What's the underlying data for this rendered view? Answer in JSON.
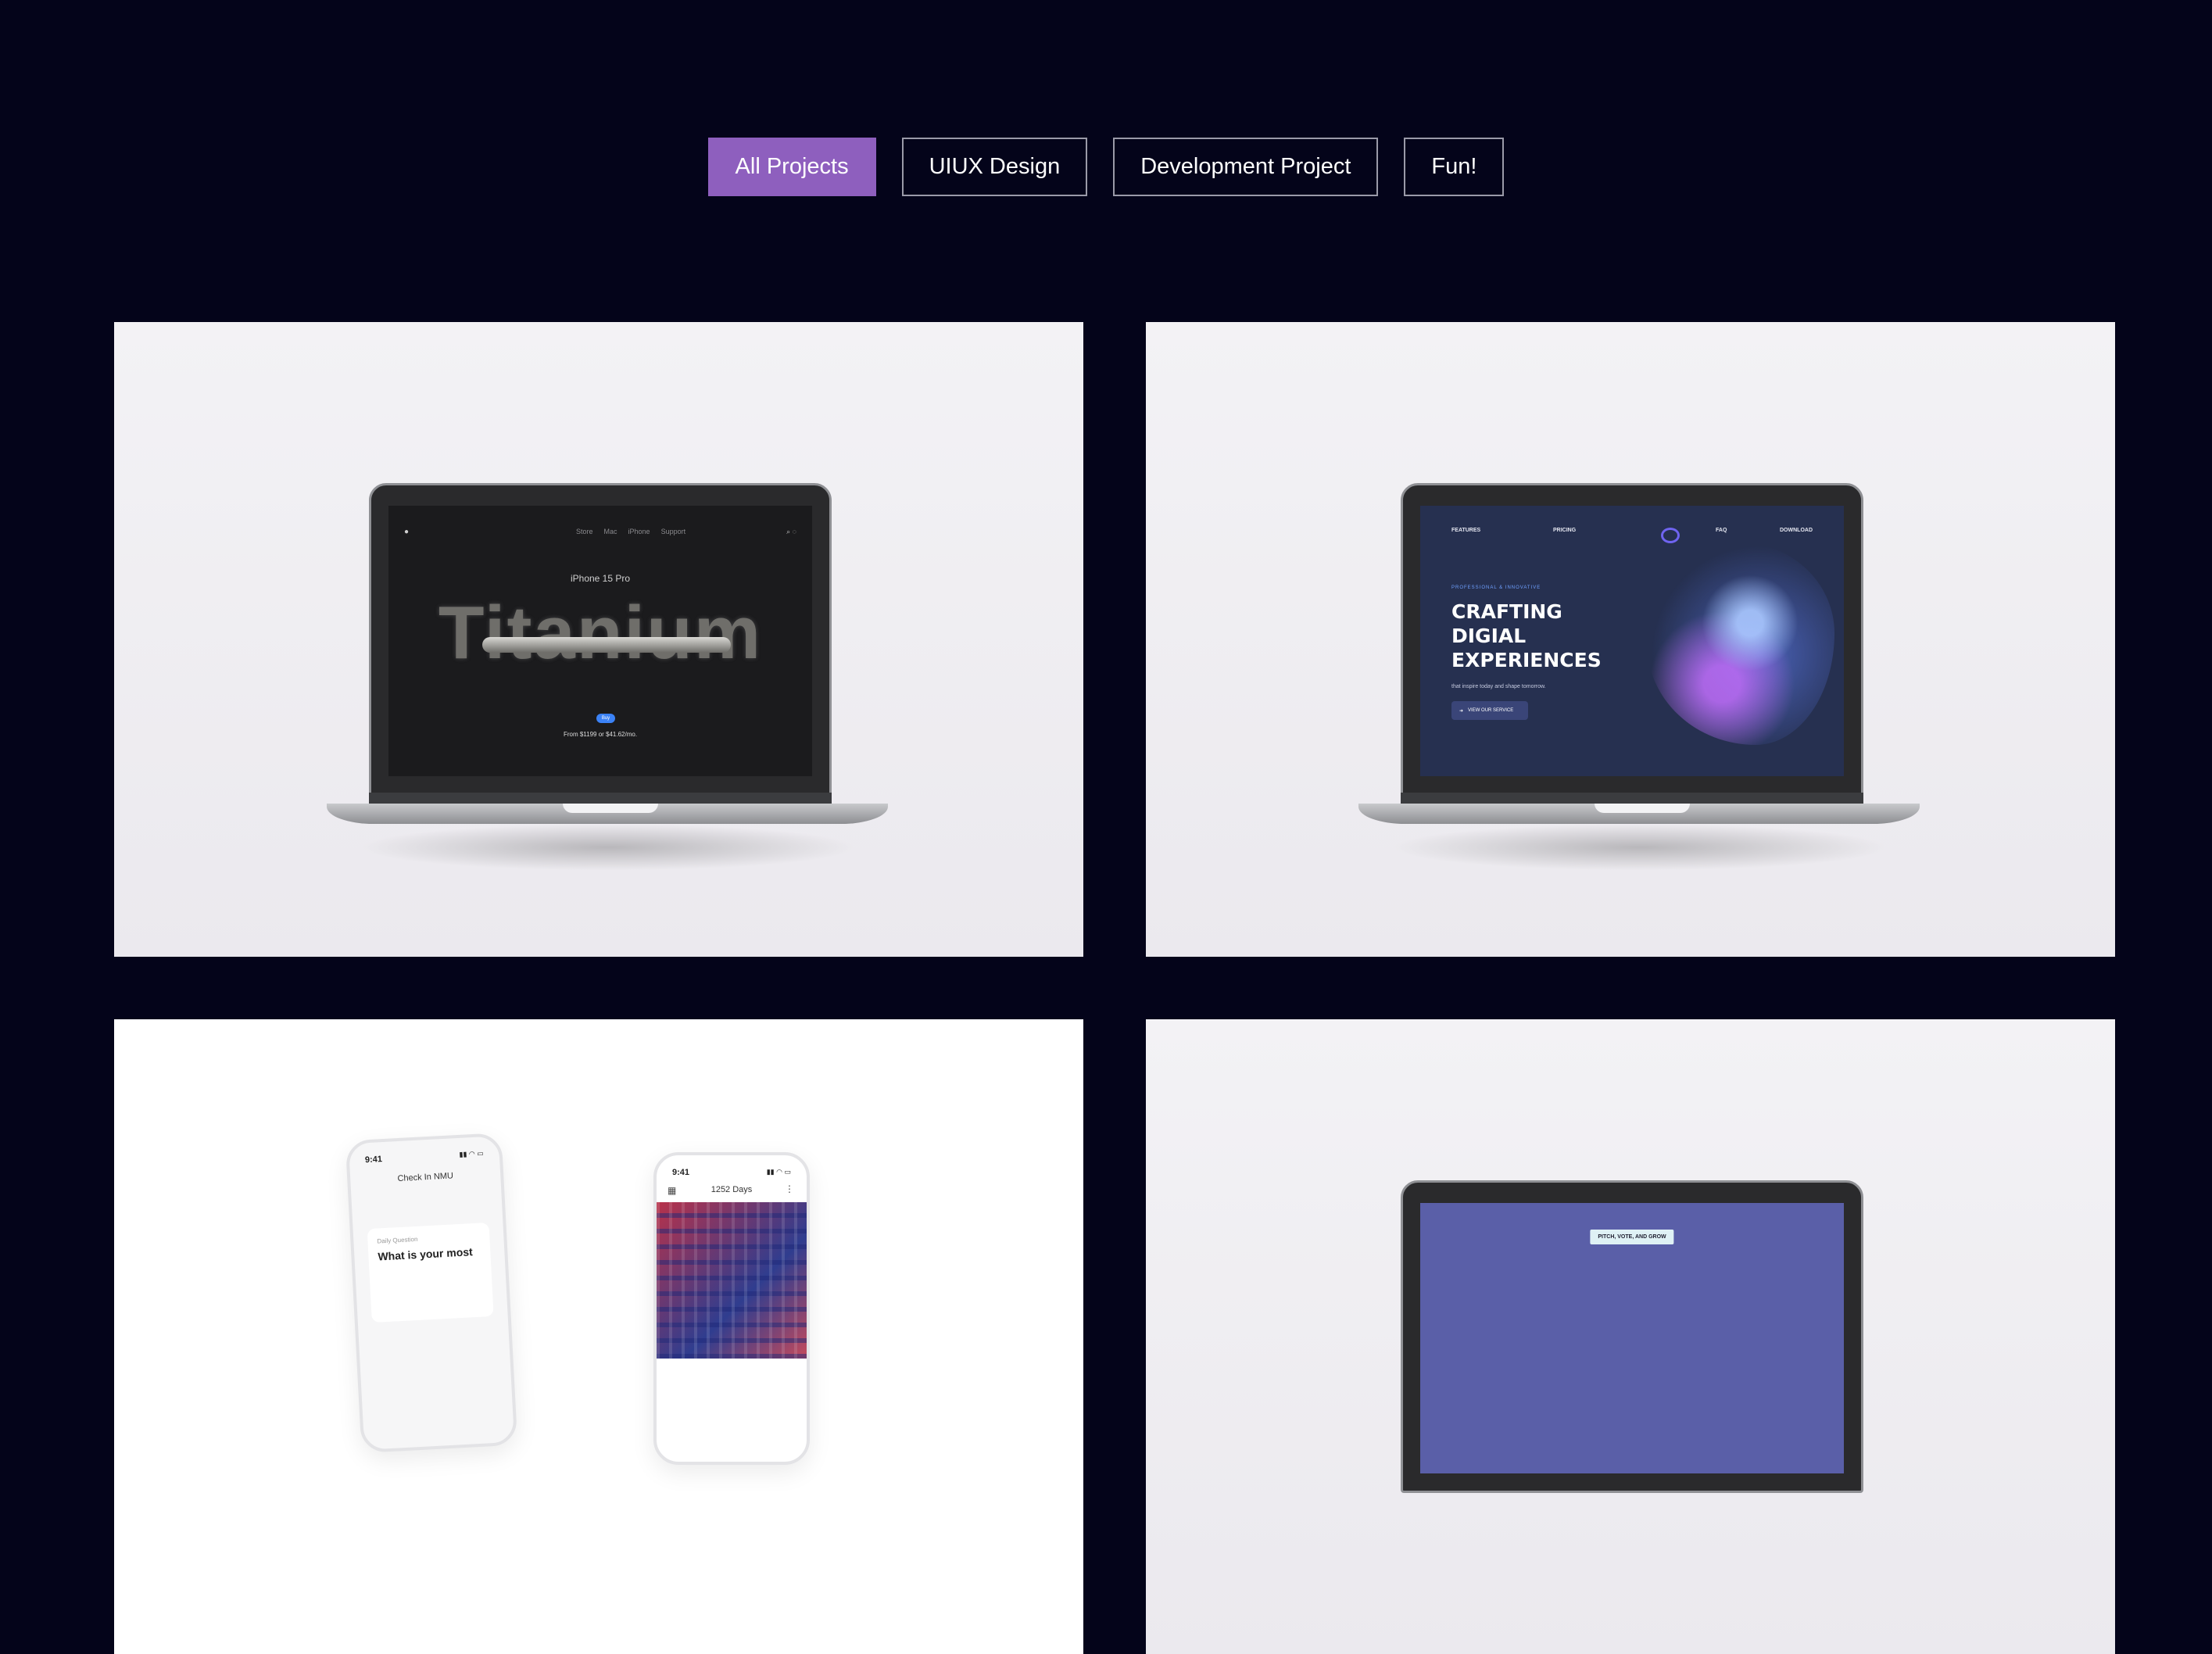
{
  "filters": [
    {
      "label": "All Projects",
      "active": true
    },
    {
      "label": "UIUX Design",
      "active": false
    },
    {
      "label": "Development Project",
      "active": false
    },
    {
      "label": "Fun!",
      "active": false
    }
  ],
  "colors": {
    "page_background": "#04041a",
    "accent": "#8e5fbe",
    "card_background": "#f1f0f3"
  },
  "project1": {
    "nav_links": [
      "Store",
      "Mac",
      "iPhone",
      "Support"
    ],
    "model": "iPhone 15 Pro",
    "headline": "Titanium",
    "buy": "Buy",
    "price": "From $1199 or $41.62/mo."
  },
  "project2": {
    "nav": [
      "FEATURES",
      "PRICING",
      "FAQ",
      "DOWNLOAD"
    ],
    "eyebrow": "PROFESSIONAL & INNOVATIVE",
    "headline_lines": [
      "CRAFTING",
      "DIGIAL",
      "EXPERIENCES"
    ],
    "subtitle": "that inspire today and shape tomorrow.",
    "cta": "VIEW OUR SERVICE"
  },
  "project3": {
    "phone1": {
      "time": "9:41",
      "title": "Check In NMU",
      "label": "Daily Question",
      "question": "What is your most"
    },
    "phone2": {
      "time": "9:41",
      "days": "1252 Days"
    }
  },
  "project4": {
    "pill": "PITCH, VOTE, AND GROW"
  }
}
